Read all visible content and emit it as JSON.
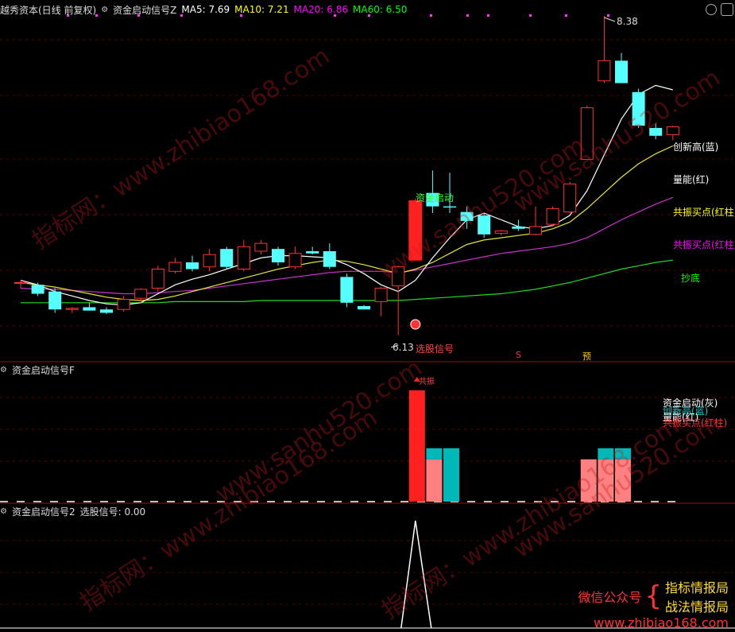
{
  "main_panel": {
    "title": "越秀资本(日线 前复权)",
    "indicator": "资金启动信号Z",
    "ma": [
      {
        "label": "MA5: 7.69",
        "color": "#ffffff"
      },
      {
        "label": "MA10: 7.21",
        "color": "#ffff00"
      },
      {
        "label": "MA20: 6.86",
        "color": "#ff00ff"
      },
      {
        "label": "MA60: 6.50",
        "color": "#00ff00"
      }
    ],
    "high_label": "8.38",
    "low_label": "6.13",
    "signal_capital": "资金启动",
    "signal_pick": "选股信号",
    "marker_s": "S",
    "marker_yu": "预",
    "legend": [
      {
        "text": "创新高(蓝)",
        "color": "#ffffff"
      },
      {
        "text": "量能(红)",
        "color": "#ffffff"
      },
      {
        "text": "共振买点(红柱)",
        "color": "#ffff00"
      },
      {
        "text": "共振买点(红柱)",
        "color": "#ff00ff"
      },
      {
        "text": "抄底",
        "color": "#00ff00"
      }
    ],
    "candles": [
      {
        "o": 6.6,
        "h": 6.62,
        "l": 6.55,
        "c": 6.6
      },
      {
        "o": 6.58,
        "h": 6.6,
        "l": 6.48,
        "c": 6.5
      },
      {
        "o": 6.52,
        "h": 6.55,
        "l": 6.33,
        "c": 6.36
      },
      {
        "o": 6.36,
        "h": 6.38,
        "l": 6.33,
        "c": 6.37
      },
      {
        "o": 6.38,
        "h": 6.42,
        "l": 6.35,
        "c": 6.35
      },
      {
        "o": 6.36,
        "h": 6.38,
        "l": 6.32,
        "c": 6.33
      },
      {
        "o": 6.36,
        "h": 6.48,
        "l": 6.34,
        "c": 6.45
      },
      {
        "o": 6.46,
        "h": 6.55,
        "l": 6.42,
        "c": 6.54
      },
      {
        "o": 6.55,
        "h": 6.75,
        "l": 6.52,
        "c": 6.72
      },
      {
        "o": 6.7,
        "h": 6.82,
        "l": 6.68,
        "c": 6.78
      },
      {
        "o": 6.78,
        "h": 6.84,
        "l": 6.7,
        "c": 6.72
      },
      {
        "o": 6.74,
        "h": 6.9,
        "l": 6.7,
        "c": 6.85
      },
      {
        "o": 6.9,
        "h": 6.92,
        "l": 6.72,
        "c": 6.74
      },
      {
        "o": 6.72,
        "h": 6.98,
        "l": 6.7,
        "c": 6.92
      },
      {
        "o": 6.88,
        "h": 6.98,
        "l": 6.85,
        "c": 6.95
      },
      {
        "o": 6.9,
        "h": 6.92,
        "l": 6.75,
        "c": 6.78
      },
      {
        "o": 6.74,
        "h": 6.92,
        "l": 6.72,
        "c": 6.86
      },
      {
        "o": 6.88,
        "h": 6.92,
        "l": 6.85,
        "c": 6.86
      },
      {
        "o": 6.88,
        "h": 6.95,
        "l": 6.72,
        "c": 6.74
      },
      {
        "o": 6.65,
        "h": 6.68,
        "l": 6.38,
        "c": 6.42
      },
      {
        "o": 6.39,
        "h": 6.4,
        "l": 6.36,
        "c": 6.36
      },
      {
        "o": 6.43,
        "h": 6.56,
        "l": 6.3,
        "c": 6.55
      },
      {
        "o": 6.57,
        "h": 6.75,
        "l": 6.13,
        "c": 6.74
      },
      {
        "o": 6.8,
        "h": 7.35,
        "l": 6.8,
        "c": 7.33
      },
      {
        "o": 7.4,
        "h": 7.6,
        "l": 7.22,
        "c": 7.28
      },
      {
        "o": 7.28,
        "h": 7.58,
        "l": 7.22,
        "c": 7.27
      },
      {
        "o": 7.23,
        "h": 7.28,
        "l": 7.08,
        "c": 7.15
      },
      {
        "o": 7.2,
        "h": 7.22,
        "l": 7.0,
        "c": 7.03
      },
      {
        "o": 7.04,
        "h": 7.07,
        "l": 7.02,
        "c": 7.06
      },
      {
        "o": 7.1,
        "h": 7.16,
        "l": 7.06,
        "c": 7.08
      },
      {
        "o": 7.03,
        "h": 7.28,
        "l": 7.02,
        "c": 7.1
      },
      {
        "o": 7.12,
        "h": 7.28,
        "l": 7.1,
        "c": 7.26
      },
      {
        "o": 7.23,
        "h": 7.5,
        "l": 7.22,
        "c": 7.48
      },
      {
        "o": 7.7,
        "h": 8.18,
        "l": 7.7,
        "c": 8.16
      },
      {
        "o": 8.4,
        "h": 8.98,
        "l": 8.38,
        "c": 8.58
      },
      {
        "o": 8.58,
        "h": 8.65,
        "l": 8.38,
        "c": 8.38
      },
      {
        "o": 8.3,
        "h": 8.33,
        "l": 7.98,
        "c": 8.0
      },
      {
        "o": 7.98,
        "h": 8.02,
        "l": 7.88,
        "c": 7.91
      },
      {
        "o": 7.92,
        "h": 8.0,
        "l": 7.87,
        "c": 7.99
      }
    ],
    "ma5": [
      6.62,
      6.58,
      6.52,
      6.48,
      6.44,
      6.41,
      6.4,
      6.42,
      6.5,
      6.58,
      6.63,
      6.67,
      6.72,
      6.77,
      6.82,
      6.84,
      6.84,
      6.83,
      6.82,
      6.76,
      6.68,
      6.58,
      6.52,
      6.62,
      6.82,
      7.0,
      7.16,
      7.22,
      7.16,
      7.1,
      7.08,
      7.11,
      7.2,
      7.42,
      7.74,
      8.06,
      8.28,
      8.36,
      8.32
    ],
    "ma10": [
      6.6,
      6.58,
      6.56,
      6.53,
      6.5,
      6.47,
      6.45,
      6.44,
      6.45,
      6.48,
      6.52,
      6.56,
      6.6,
      6.64,
      6.68,
      6.72,
      6.75,
      6.78,
      6.8,
      6.79,
      6.76,
      6.72,
      6.68,
      6.72,
      6.78,
      6.86,
      6.94,
      6.98,
      7.0,
      7.02,
      7.04,
      7.08,
      7.14,
      7.26,
      7.4,
      7.54,
      7.66,
      7.75,
      7.82
    ],
    "ma20": [
      6.55,
      6.54,
      6.54,
      6.53,
      6.52,
      6.51,
      6.5,
      6.5,
      6.51,
      6.52,
      6.53,
      6.55,
      6.57,
      6.59,
      6.61,
      6.63,
      6.65,
      6.67,
      6.69,
      6.7,
      6.7,
      6.7,
      6.69,
      6.71,
      6.74,
      6.77,
      6.8,
      6.83,
      6.86,
      6.88,
      6.9,
      6.92,
      6.95,
      7.0,
      7.08,
      7.16,
      7.23,
      7.3,
      7.36
    ],
    "ma60": [
      6.42,
      6.42,
      6.42,
      6.42,
      6.42,
      6.42,
      6.42,
      6.42,
      6.42,
      6.43,
      6.43,
      6.43,
      6.43,
      6.43,
      6.44,
      6.44,
      6.44,
      6.44,
      6.44,
      6.44,
      6.44,
      6.44,
      6.44,
      6.45,
      6.46,
      6.47,
      6.48,
      6.49,
      6.5,
      6.52,
      6.54,
      6.57,
      6.6,
      6.64,
      6.68,
      6.72,
      6.75,
      6.78,
      6.8
    ]
  },
  "sub_panel_1": {
    "title": "资金启动信号F",
    "signal_label": "共振",
    "legend": [
      {
        "text": "资金启动(灰)",
        "color": "#ffffff"
      },
      {
        "text": "创新高(蓝)",
        "color": "#00cccc"
      },
      {
        "text": "量能(红)",
        "color": "#ffffff"
      },
      {
        "text": "共振买点(红柱)",
        "color": "#ff3333"
      }
    ],
    "bars": [
      {
        "i": 23,
        "h": 1.0,
        "color": "#ff2020"
      },
      {
        "i": 24,
        "h": 0.38,
        "color": "#ff8080",
        "top": 0.1,
        "topColor": "#00b8b8"
      },
      {
        "i": 25,
        "h": 0.48,
        "color": "#00b8b8"
      },
      {
        "i": 33,
        "h": 0.38,
        "color": "#ff8080"
      },
      {
        "i": 34,
        "h": 0.38,
        "color": "#ff8080",
        "top": 0.1,
        "topColor": "#00b8b8"
      },
      {
        "i": 35,
        "h": 0.38,
        "color": "#ff8080",
        "top": 0.1,
        "topColor": "#00b8b8"
      }
    ]
  },
  "sub_panel_2": {
    "title": "资金启动信号2",
    "value_label": "选股信号: 0.00",
    "spike_index": 23
  },
  "footer": {
    "wechat": "微信公众号",
    "line1": "指标情报局",
    "line2": "战法情报局",
    "url": "www.zhibiao168.com"
  },
  "watermarks": [
    "指标网：www.zhibiao168.com",
    "www.sanhu520.com",
    "指标网：www.zhibiao168.com",
    "www.sanhu520.com",
    "指标网：www.zhibiao168.com",
    "www.sanhu520.com",
    "指标网：www.zhibiao168.com"
  ]
}
